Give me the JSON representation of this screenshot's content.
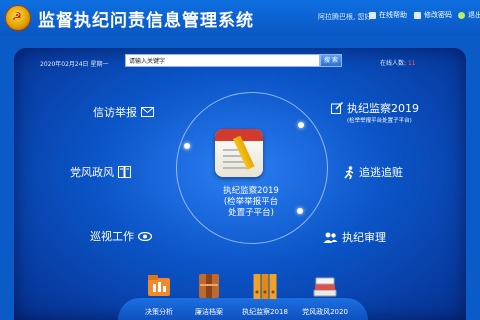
{
  "header": {
    "title": "监督执纪问责信息管理系统",
    "greeting": "阿拉腾巴根, 您好",
    "links": [
      {
        "label": "在线帮助",
        "icon": "help-icon"
      },
      {
        "label": "修改密码",
        "icon": "key-icon"
      },
      {
        "label": "退出",
        "icon": "exit-icon"
      }
    ]
  },
  "toolbar": {
    "date": "2020年02月24日  星期一",
    "search_placeholder": "请输入关键字",
    "search_button": "搜 索",
    "online_label": "在线人数:",
    "online_count": "11"
  },
  "modules": {
    "xinfang": {
      "label": "信访举报",
      "icon": "envelope-icon"
    },
    "jiufeng": {
      "label": "党风政风",
      "icon": "book-icon"
    },
    "xunshi": {
      "label": "巡视工作",
      "icon": "eye-icon"
    },
    "jijian": {
      "label": "执纪监察2019",
      "sub": "(检举举报平台处置子平台)",
      "icon": "edit-icon"
    },
    "zhuitao": {
      "label": "追逃追赃",
      "icon": "runner-icon"
    },
    "shenli": {
      "label": "执纪审理",
      "icon": "users-icon"
    }
  },
  "center": {
    "line1": "执纪监察2019",
    "line2": "(检举举报平台",
    "line3": "处置子平台)",
    "icon": "notebook-pencil-icon"
  },
  "bottom_nav": [
    {
      "label": "决策分析",
      "icon": "folder-chart-icon"
    },
    {
      "label": "廉洁档案",
      "icon": "archive-box-icon"
    },
    {
      "label": "执纪监察2018",
      "icon": "binders-icon"
    },
    {
      "label": "党风政风2020",
      "icon": "books-stack-icon"
    }
  ]
}
